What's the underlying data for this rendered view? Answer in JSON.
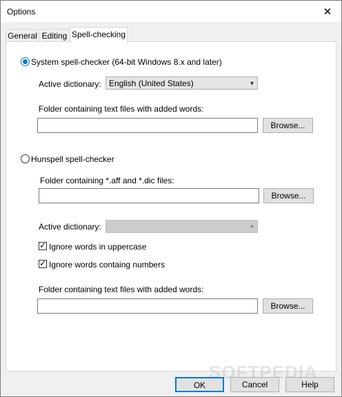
{
  "window": {
    "title": "Options",
    "close_glyph": "✕"
  },
  "tabs": [
    {
      "label": "General"
    },
    {
      "label": "Editing"
    },
    {
      "label": "Spell-checking"
    }
  ],
  "system_checker": {
    "radio_label": "System spell-checker (64-bit Windows 8.x and later)",
    "dictionary_label": "Active dictionary:",
    "dictionary_value": "English (United States)",
    "folder_label": "Folder containing text files with added words:",
    "folder_value": "",
    "browse_label": "Browse..."
  },
  "hunspell": {
    "radio_label": "Hunspell spell-checker",
    "aff_dic_label": "Folder containing *.aff and *.dic files:",
    "aff_dic_value": "",
    "browse_label": "Browse...",
    "dictionary_label": "Active dictionary:",
    "dictionary_value": "",
    "ignore_uppercase_label": "Ignore words in uppercase",
    "ignore_numbers_label": "Ignore words containg numbers",
    "folder_label": "Folder containing text files with added words:",
    "folder_value": "",
    "browse2_label": "Browse..."
  },
  "footer": {
    "ok": "OK",
    "cancel": "Cancel",
    "help": "Help"
  },
  "watermark": "SOFTPEDIA",
  "state": {
    "selected_checker": "system",
    "ignore_uppercase": true,
    "ignore_numbers": true,
    "active_tab": "Spell-checking"
  }
}
